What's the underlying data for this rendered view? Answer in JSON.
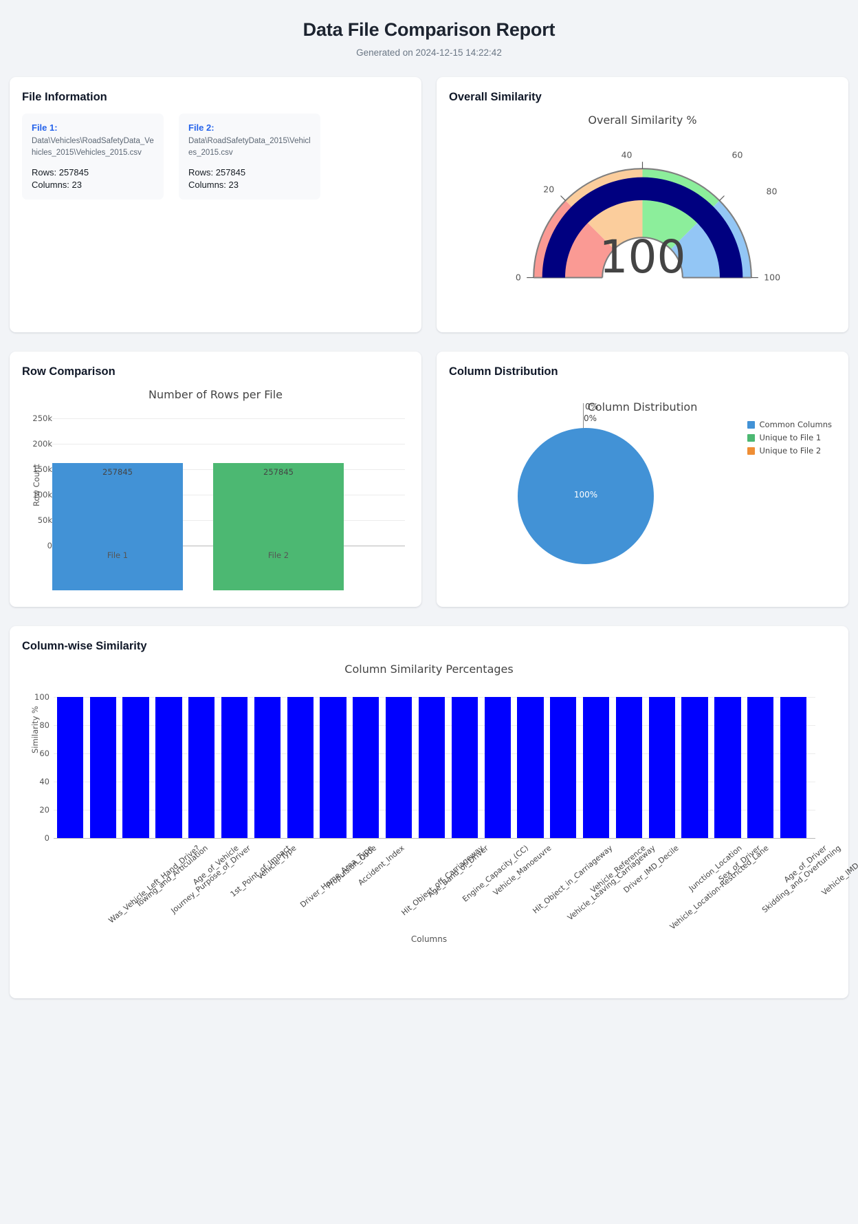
{
  "header": {
    "title": "Data File Comparison Report",
    "subtitle": "Generated on 2024-12-15 14:22:42"
  },
  "file_information": {
    "card_title": "File Information",
    "files": [
      {
        "label": "File 1:",
        "path": "Data\\Vehicles\\RoadSafetyData_Vehicles_2015\\Vehicles_2015.csv",
        "rows": "Rows: 257845",
        "columns": "Columns: 23"
      },
      {
        "label": "File 2:",
        "path": "Data\\RoadSafetyData_2015\\Vehicles_2015.csv",
        "rows": "Rows: 257845",
        "columns": "Columns: 23"
      }
    ]
  },
  "overall_similarity": {
    "card_title": "Overall Similarity",
    "chart_data": {
      "type": "gauge",
      "title": "Overall Similarity %",
      "value": 100,
      "value_text": "100",
      "axis_range": [
        0,
        100
      ],
      "tick_labels": [
        "0",
        "20",
        "40",
        "60",
        "80",
        "100"
      ],
      "tick_values": [
        0,
        20,
        40,
        60,
        80,
        100
      ],
      "steps": [
        {
          "range": [
            0,
            25
          ],
          "color": "#FA9A94"
        },
        {
          "range": [
            25,
            50
          ],
          "color": "#FBCD9C"
        },
        {
          "range": [
            50,
            75
          ],
          "color": "#8CEE9B"
        },
        {
          "range": [
            75,
            100
          ],
          "color": "#93C6F5"
        }
      ],
      "bar_color": "#000080",
      "border_color": "#7f7f7f"
    }
  },
  "row_comparison": {
    "card_title": "Row Comparison",
    "chart_data": {
      "type": "bar",
      "title": "Number of Rows per File",
      "categories": [
        "File 1",
        "File 2"
      ],
      "values": [
        257845,
        257845
      ],
      "value_labels": [
        "257845",
        "257845"
      ],
      "colors": [
        "#4292d6",
        "#4cb872"
      ],
      "xlabel": "",
      "ylabel": "Row Count",
      "ylim": [
        0,
        260000
      ],
      "ytick_labels": [
        "0",
        "50k",
        "100k",
        "150k",
        "200k",
        "250k"
      ],
      "ytick_values": [
        0,
        50000,
        100000,
        150000,
        200000,
        250000
      ],
      "grid": true
    }
  },
  "column_distribution": {
    "card_title": "Column Distribution",
    "chart_data": {
      "type": "pie",
      "title": "Column Distribution",
      "labels": [
        "Common Columns",
        "Unique to File 1",
        "Unique to File 2"
      ],
      "values": [
        23,
        0,
        0
      ],
      "percent_labels": [
        "100%",
        "0%",
        "0%"
      ],
      "colors": [
        "#4292d6",
        "#4cb872",
        "#ef8e35"
      ],
      "legend_position": "right"
    }
  },
  "column_similarity": {
    "card_title": "Column-wise Similarity",
    "chart_data": {
      "type": "bar",
      "title": "Column Similarity Percentages",
      "xlabel": "Columns",
      "ylabel": "Similarity %",
      "ylim": [
        0,
        100
      ],
      "ytick_labels": [
        "0",
        "20",
        "40",
        "60",
        "80",
        "100"
      ],
      "ytick_values": [
        0,
        20,
        40,
        60,
        80,
        100
      ],
      "bar_color": "#0000FF",
      "grid": true,
      "categories": [
        "Was_Vehicle_Left_Hand_Drive?",
        "Towing_and_Articulation",
        "Journey_Purpose_of_Driver",
        "Age_of_Vehicle",
        "1st_Point_of_Impact",
        "Vehicle_Type",
        "Driver_Home_Area_Type",
        "Propulsion_Code",
        "Accident_Index",
        "Hit_Object_off_Carriageway",
        "Age_Band_of_Driver",
        "Engine_Capacity_(CC)",
        "Vehicle_Manoeuvre",
        "Hit_Object_in_Carriageway",
        "Vehicle_Leaving_Carriageway",
        "Vehicle_Reference",
        "Driver_IMD_Decile",
        "Vehicle_Location-Restricted_Lane",
        "Junction_Location",
        "Sex_of_Driver",
        "Skidding_and_Overturning",
        "Age_of_Driver",
        "Vehicle_IMD_Decile"
      ],
      "values": [
        100,
        100,
        100,
        100,
        100,
        100,
        100,
        100,
        100,
        100,
        100,
        100,
        100,
        100,
        100,
        100,
        100,
        100,
        100,
        100,
        100,
        100,
        100
      ]
    }
  }
}
